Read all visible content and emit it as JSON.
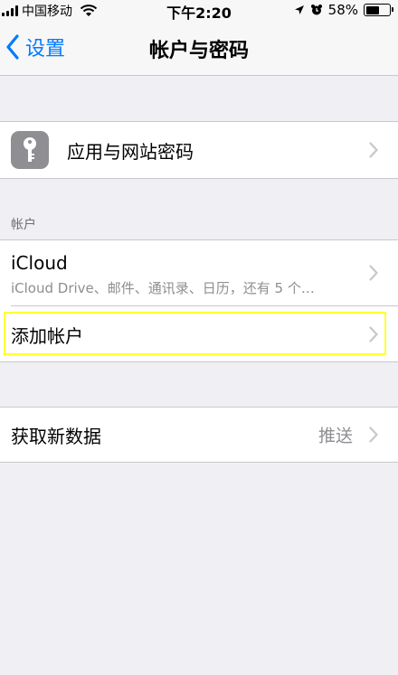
{
  "status_bar": {
    "carrier": "中国移动",
    "time": "下午2:20",
    "battery": "58%",
    "battery_level": 0.58
  },
  "nav": {
    "back_label": "设置",
    "title": "帐户与密码"
  },
  "passwords_row": {
    "label": "应用与网站密码",
    "icon": "key-icon"
  },
  "accounts_section": {
    "header": "帐户",
    "icloud_title": "iCloud",
    "icloud_subtitle": "iCloud Drive、邮件、通讯录、日历，还有 5 个…",
    "add_account_label": "添加帐户"
  },
  "fetch_row": {
    "label": "获取新数据",
    "value": "推送"
  },
  "colors": {
    "accent": "#007aff",
    "highlight": "#ffff33",
    "background": "#efeff4"
  }
}
